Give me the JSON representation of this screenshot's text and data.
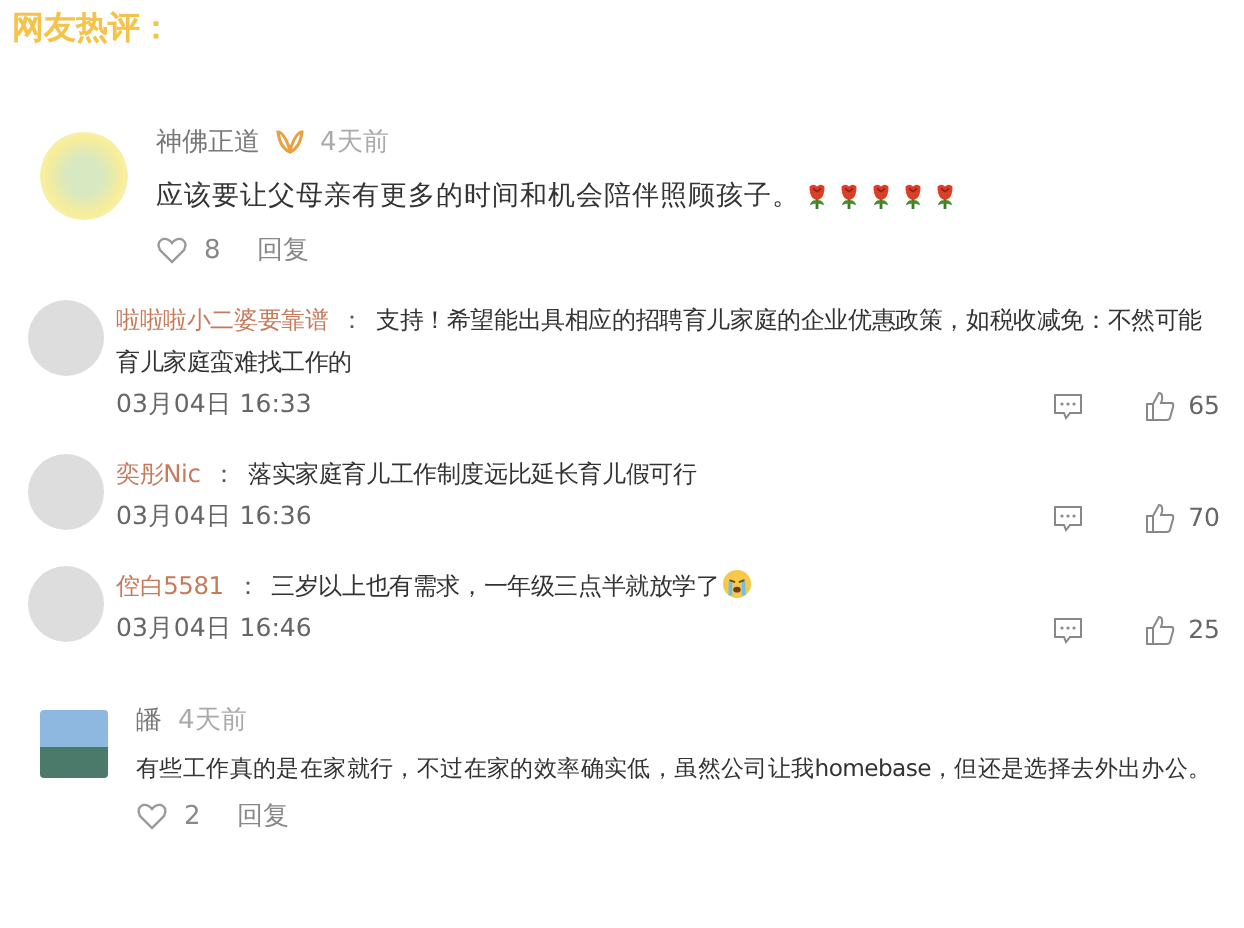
{
  "heading": "网友热评：",
  "comments": [
    {
      "kind": "feed",
      "user": "神佛正道",
      "badge": true,
      "time": "4天前",
      "text": "应该要让父母亲有更多的时间和机会陪伴照顾孩子。",
      "emojis": [
        {
          "kind": "rose"
        },
        {
          "kind": "rose"
        },
        {
          "kind": "rose"
        },
        {
          "kind": "rose"
        },
        {
          "kind": "rose"
        }
      ],
      "likes": "8",
      "reply": "回复"
    },
    {
      "kind": "reply",
      "user": "啦啦啦小二婆要靠谱",
      "separator": "：",
      "text": "支持！希望能出具相应的招聘育儿家庭的企业优惠政策，如税收减免：不然可能育儿家庭蛮难找工作的",
      "time": "03月04日 16:33",
      "likes": "65"
    },
    {
      "kind": "reply",
      "user": "奕彤Nic",
      "separator": "：",
      "text": "落实家庭育儿工作制度远比延长育儿假可行",
      "time": "03月04日 16:36",
      "likes": "70"
    },
    {
      "kind": "reply",
      "user": "倥白5581",
      "separator": "：",
      "text": "三岁以上也有需求，一年级三点半就放学了",
      "emojis": [
        {
          "kind": "crying"
        }
      ],
      "time": "03月04日 16:46",
      "likes": "25"
    },
    {
      "kind": "feed",
      "user": "皤",
      "badge": false,
      "time": "4天前",
      "text": "有些工作真的是在家就行，不过在家的效率确实低，虽然公司让我homebase，但还是选择去外出办公。",
      "likes": "2",
      "reply": "回复"
    }
  ]
}
